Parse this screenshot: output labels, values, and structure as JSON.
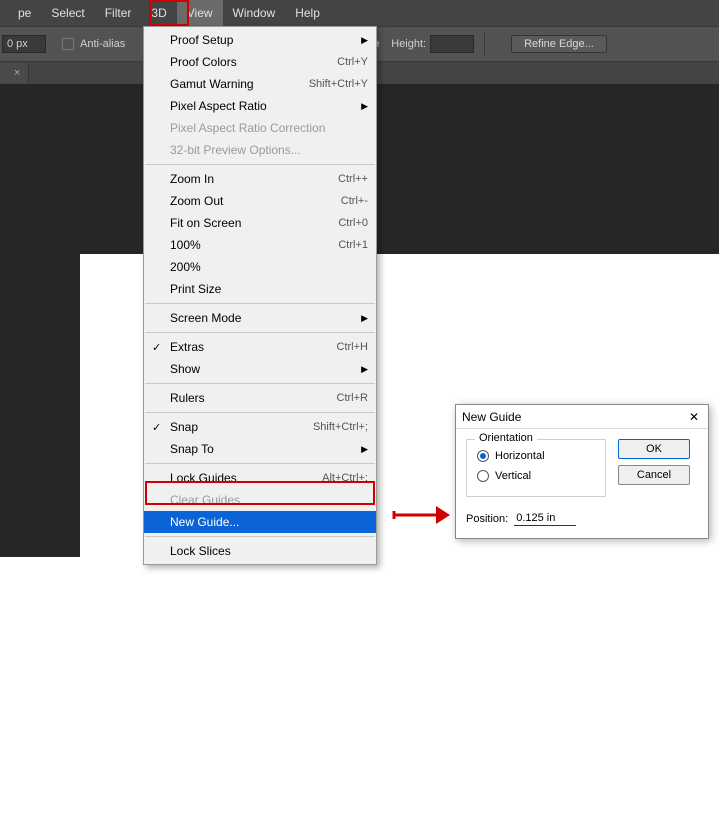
{
  "menubar": {
    "items": [
      "pe",
      "Select",
      "Filter",
      "3D",
      "View",
      "Window",
      "Help"
    ],
    "active_index": 4
  },
  "optionsbar": {
    "value_field": "0 px",
    "antialias_label": "Anti-alias",
    "height_label": "Height:",
    "height_value": "",
    "refine_label": "Refine Edge..."
  },
  "tabbar": {
    "close_glyph": "×"
  },
  "dropdown": {
    "groups": [
      [
        {
          "label": "Proof Setup",
          "shortcut": "",
          "sub": true
        },
        {
          "label": "Proof Colors",
          "shortcut": "Ctrl+Y"
        },
        {
          "label": "Gamut Warning",
          "shortcut": "Shift+Ctrl+Y"
        },
        {
          "label": "Pixel Aspect Ratio",
          "shortcut": "",
          "sub": true
        },
        {
          "label": "Pixel Aspect Ratio Correction",
          "shortcut": "",
          "disabled": true
        },
        {
          "label": "32-bit Preview Options...",
          "shortcut": "",
          "disabled": true
        }
      ],
      [
        {
          "label": "Zoom In",
          "shortcut": "Ctrl++"
        },
        {
          "label": "Zoom Out",
          "shortcut": "Ctrl+-"
        },
        {
          "label": "Fit on Screen",
          "shortcut": "Ctrl+0"
        },
        {
          "label": "100%",
          "shortcut": "Ctrl+1"
        },
        {
          "label": "200%",
          "shortcut": ""
        },
        {
          "label": "Print Size",
          "shortcut": ""
        }
      ],
      [
        {
          "label": "Screen Mode",
          "shortcut": "",
          "sub": true
        }
      ],
      [
        {
          "label": "Extras",
          "shortcut": "Ctrl+H",
          "checked": true
        },
        {
          "label": "Show",
          "shortcut": "",
          "sub": true
        }
      ],
      [
        {
          "label": "Rulers",
          "shortcut": "Ctrl+R"
        }
      ],
      [
        {
          "label": "Snap",
          "shortcut": "Shift+Ctrl+;",
          "checked": true
        },
        {
          "label": "Snap To",
          "shortcut": "",
          "sub": true
        }
      ],
      [
        {
          "label": "Lock Guides",
          "shortcut": "Alt+Ctrl+;"
        },
        {
          "label": "Clear Guides",
          "shortcut": "",
          "disabled": true
        },
        {
          "label": "New Guide...",
          "shortcut": "",
          "selected": true
        }
      ],
      [
        {
          "label": "Lock Slices",
          "shortcut": ""
        }
      ]
    ]
  },
  "dialog": {
    "title": "New Guide",
    "close_glyph": "✕",
    "orientation_label": "Orientation",
    "horizontal_label": "Horizontal",
    "vertical_label": "Vertical",
    "selected": "horizontal",
    "position_label": "Position:",
    "position_value": "0.125 in",
    "ok_label": "OK",
    "cancel_label": "Cancel"
  }
}
